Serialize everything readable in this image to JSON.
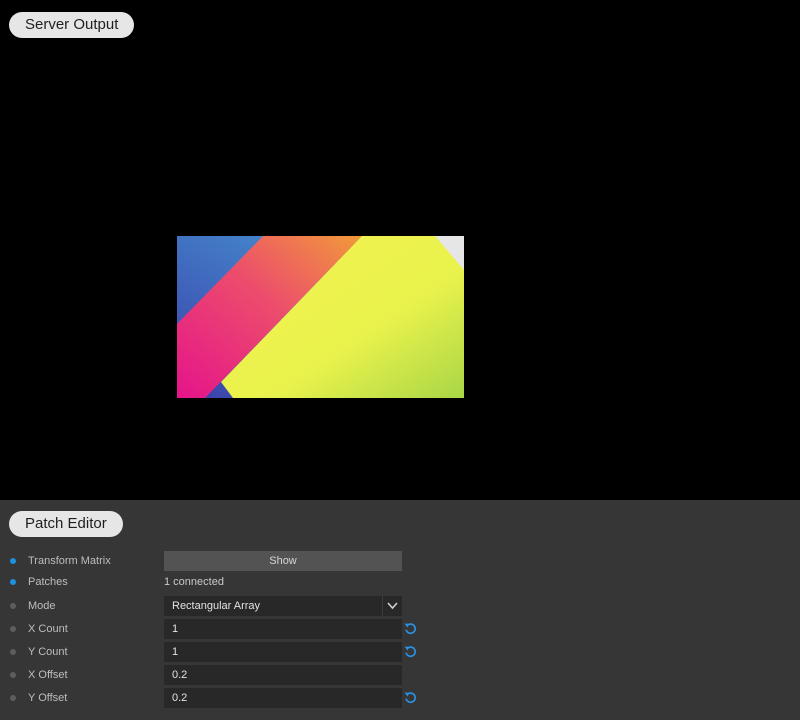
{
  "server_output": {
    "title": "Server Output"
  },
  "patch_editor": {
    "title": "Patch Editor",
    "params": [
      {
        "label": "Transform Matrix",
        "button_label": "Show",
        "indicator": "blue"
      },
      {
        "label": "Patches",
        "value": "1 connected",
        "indicator": "blue"
      },
      {
        "label": "Mode",
        "value": "Rectangular Array",
        "indicator": "gray",
        "icon": "chevron-down-icon"
      },
      {
        "label": "X Count",
        "value": "1",
        "indicator": "gray",
        "icon": "reset-icon"
      },
      {
        "label": "Y Count",
        "value": "1",
        "indicator": "gray",
        "icon": "reset-icon"
      },
      {
        "label": "X Offset",
        "value": "0.2",
        "indicator": "gray"
      },
      {
        "label": "Y Offset",
        "value": "0.2",
        "indicator": "gray",
        "icon": "reset-icon"
      }
    ]
  },
  "colors": {
    "accent": "#1f8fe0",
    "panel": "#363636",
    "field": "#282828"
  }
}
